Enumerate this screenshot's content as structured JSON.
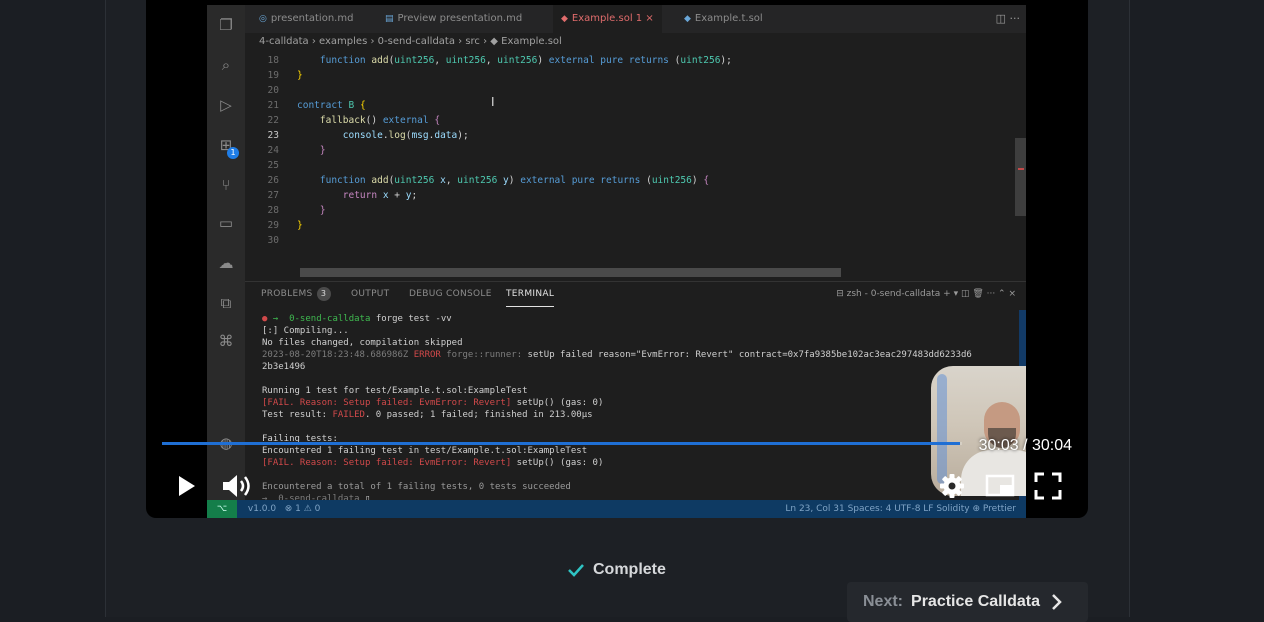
{
  "ide": {
    "tabs": [
      {
        "label": "presentation.md",
        "glyph": "◎"
      },
      {
        "label": "Preview presentation.md",
        "glyph": "▤"
      },
      {
        "label": "Example.sol 1",
        "glyph": "◆"
      },
      {
        "label": "Example.t.sol",
        "glyph": "◆"
      }
    ],
    "breadcrumb": "4-calldata  ›  examples  ›  0-send-calldata  ›  src  ›  ◆ Example.sol",
    "panel_tabs": {
      "problems": "PROBLEMS",
      "problems_count": "3",
      "output": "OUTPUT",
      "debug": "DEBUG CONSOLE",
      "terminal": "TERMINAL"
    },
    "terminal_title": "zsh - 0-send-calldata",
    "status_left": "⊗ 1 ⚠ 0",
    "status_branch": "v1.0.0",
    "status_right": "Ln 23, Col 31    Spaces: 4    UTF-8    LF    Solidity    ⊕ Prettier"
  },
  "player": {
    "time_display": "30:03 / 30:04",
    "progress_fraction": 0.998
  },
  "lesson": {
    "complete_label": "Complete",
    "next_prefix": "Next:",
    "next_label": "Practice Calldata"
  },
  "colors": {
    "progress": "#1f6fd4",
    "complete_check": "#2fc4c4"
  }
}
